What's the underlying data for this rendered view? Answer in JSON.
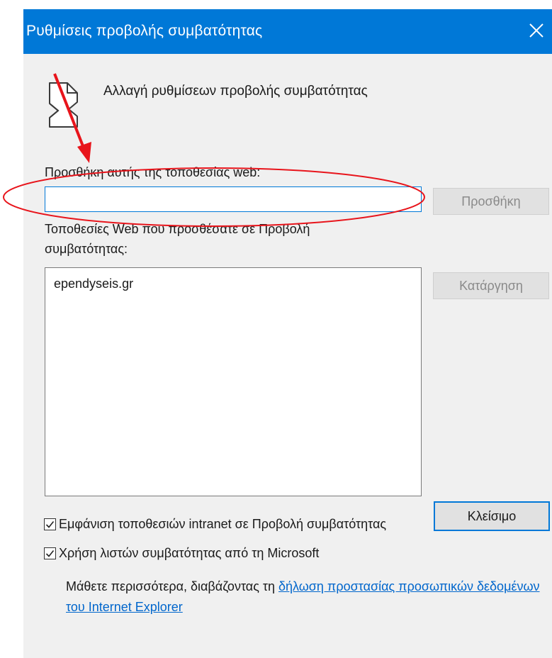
{
  "window": {
    "title": "Ρυθμίσεις προβολής συμβατότητας",
    "close_icon": "close-icon"
  },
  "header": {
    "icon": "broken-page-icon",
    "text": "Αλλαγή ρυθμίσεων προβολής συμβατότητας"
  },
  "add_site": {
    "label": "Προσθήκη αυτής της τοποθεσίας web:",
    "value": "",
    "button_label": "Προσθήκη"
  },
  "site_list": {
    "label_line1": "Τοποθεσίες Web που προσθέσατε σε Προβολή",
    "label_line2": "συμβατότητας:",
    "items": [
      "ependyseis.gr"
    ],
    "remove_button_label": "Κατάργηση"
  },
  "options": [
    {
      "label": "Εμφάνιση τοποθεσιών intranet σε Προβολή συμβατότητας",
      "checked": true
    },
    {
      "label": "Χρήση λιστών συμβατότητας από τη Microsoft",
      "checked": true
    }
  ],
  "info": {
    "text": "Μάθετε περισσότερα, διαβάζοντας τη ",
    "link_text": "δήλωση προστασίας προσωπικών δεδομένων του Internet Explorer"
  },
  "footer": {
    "close_button_label": "Κλείσιμο"
  },
  "colors": {
    "titlebar": "#0078d7",
    "dialog_background": "#f0f0f0",
    "link": "#0066cc",
    "annotation": "#e8141b"
  }
}
